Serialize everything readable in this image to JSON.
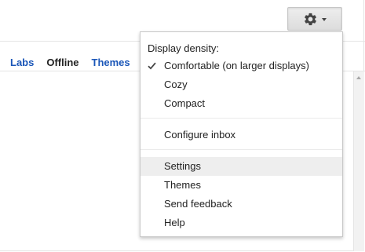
{
  "toolbar": {
    "settings_button_icon": "gear-icon",
    "settings_caret_icon": "chevron-down-icon"
  },
  "tabs": [
    {
      "label": "Labs",
      "active": false
    },
    {
      "label": "Offline",
      "active": true
    },
    {
      "label": "Themes",
      "active": false
    }
  ],
  "menu": {
    "density_heading": "Display density:",
    "density_options": [
      {
        "label": "Comfortable (on larger displays)",
        "checked": true
      },
      {
        "label": "Cozy",
        "checked": false
      },
      {
        "label": "Compact",
        "checked": false
      }
    ],
    "configure_inbox_label": "Configure inbox",
    "settings_label": "Settings",
    "themes_label": "Themes",
    "send_feedback_label": "Send feedback",
    "help_label": "Help",
    "highlighted_item": "Settings"
  },
  "colors": {
    "link": "#1a56b8",
    "menu_hover": "#eeeeee",
    "border": "#c8c8c8"
  }
}
